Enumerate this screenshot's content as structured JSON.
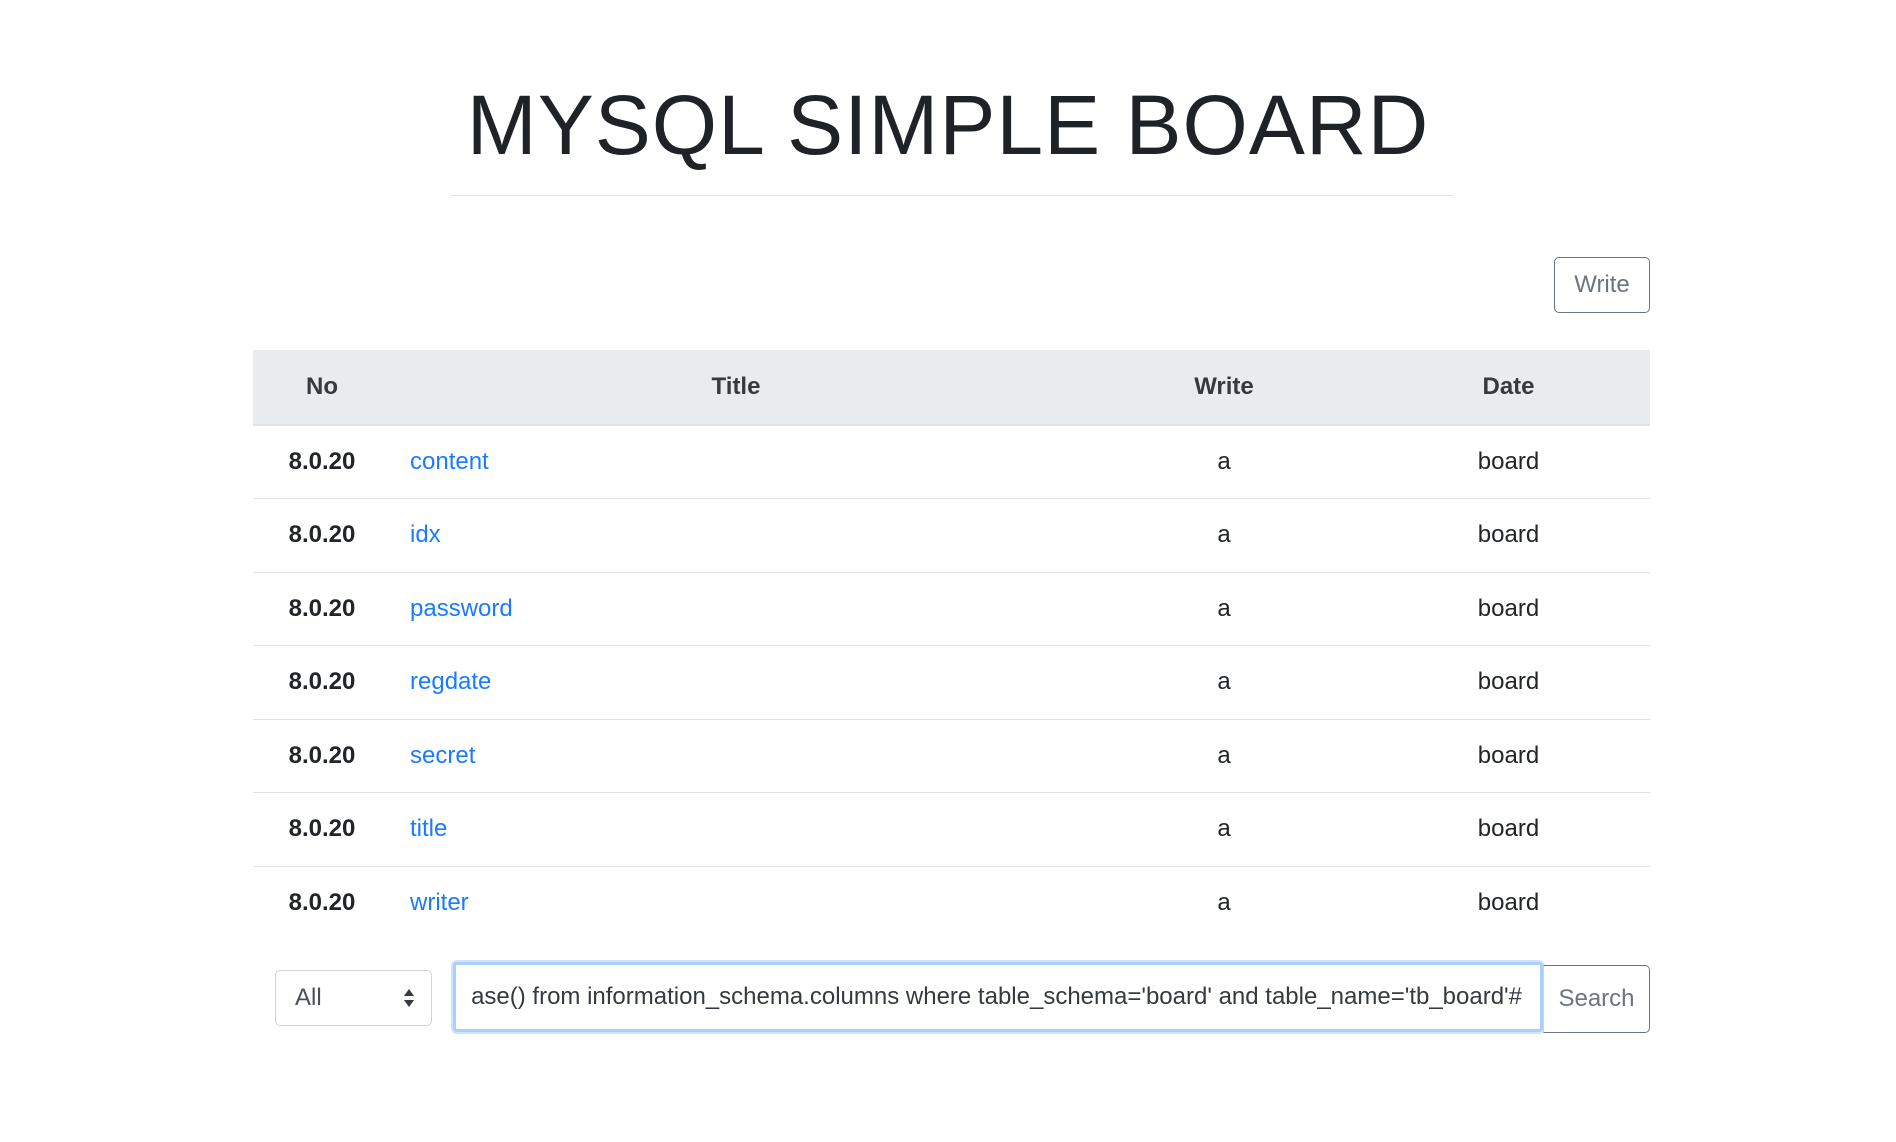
{
  "header": {
    "title": "MYSQL SIMPLE BOARD"
  },
  "toolbar": {
    "write_label": "Write"
  },
  "table": {
    "columns": [
      "No",
      "Title",
      "Write",
      "Date"
    ],
    "rows": [
      {
        "no": "8.0.20",
        "title": "content",
        "write": "a",
        "date": "board"
      },
      {
        "no": "8.0.20",
        "title": "idx",
        "write": "a",
        "date": "board"
      },
      {
        "no": "8.0.20",
        "title": "password",
        "write": "a",
        "date": "board"
      },
      {
        "no": "8.0.20",
        "title": "regdate",
        "write": "a",
        "date": "board"
      },
      {
        "no": "8.0.20",
        "title": "secret",
        "write": "a",
        "date": "board"
      },
      {
        "no": "8.0.20",
        "title": "title",
        "write": "a",
        "date": "board"
      },
      {
        "no": "8.0.20",
        "title": "writer",
        "write": "a",
        "date": "board"
      }
    ]
  },
  "search": {
    "filter_selected": "All",
    "query_value": "ase() from information_schema.columns where table_schema='board' and table_name='tb_board'#",
    "button_label": "Search"
  },
  "colors": {
    "link": "#1a7bff",
    "header_bg": "#e9ecef",
    "focus_border": "#a9d0fb",
    "secondary": "#6c757d"
  }
}
